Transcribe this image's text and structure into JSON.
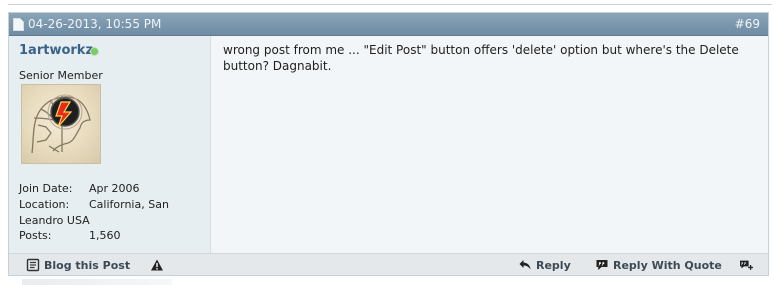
{
  "post": {
    "date": "04-26-2013, 10:55 PM",
    "number": "#69",
    "username": "1artworkz",
    "rank": "Senior Member",
    "join_date_label": "Join Date:",
    "join_date": "Apr 2006",
    "location_label": "Location:",
    "location_line1": "California, San",
    "location_line2": "Leandro USA",
    "posts_label": "Posts:",
    "posts": "1,560",
    "message": "wrong post from me ... \"Edit Post\" button offers 'delete' option but where's the Delete button? Dagnabit."
  },
  "footer": {
    "blog": "Blog this Post",
    "reply": "Reply",
    "reply_quote": "Reply With Quote"
  },
  "icons": {
    "status_online": "online-dot-icon",
    "blog": "blog-icon",
    "warning": "warning-icon",
    "reply": "reply-icon",
    "reply_quote": "reply-quote-icon",
    "multi_quote": "multiquote-icon"
  },
  "colors": {
    "header": "#7f98ad",
    "sidebar": "#e6eef2",
    "content": "#f3f6f8",
    "footer": "#e4e8eb"
  }
}
